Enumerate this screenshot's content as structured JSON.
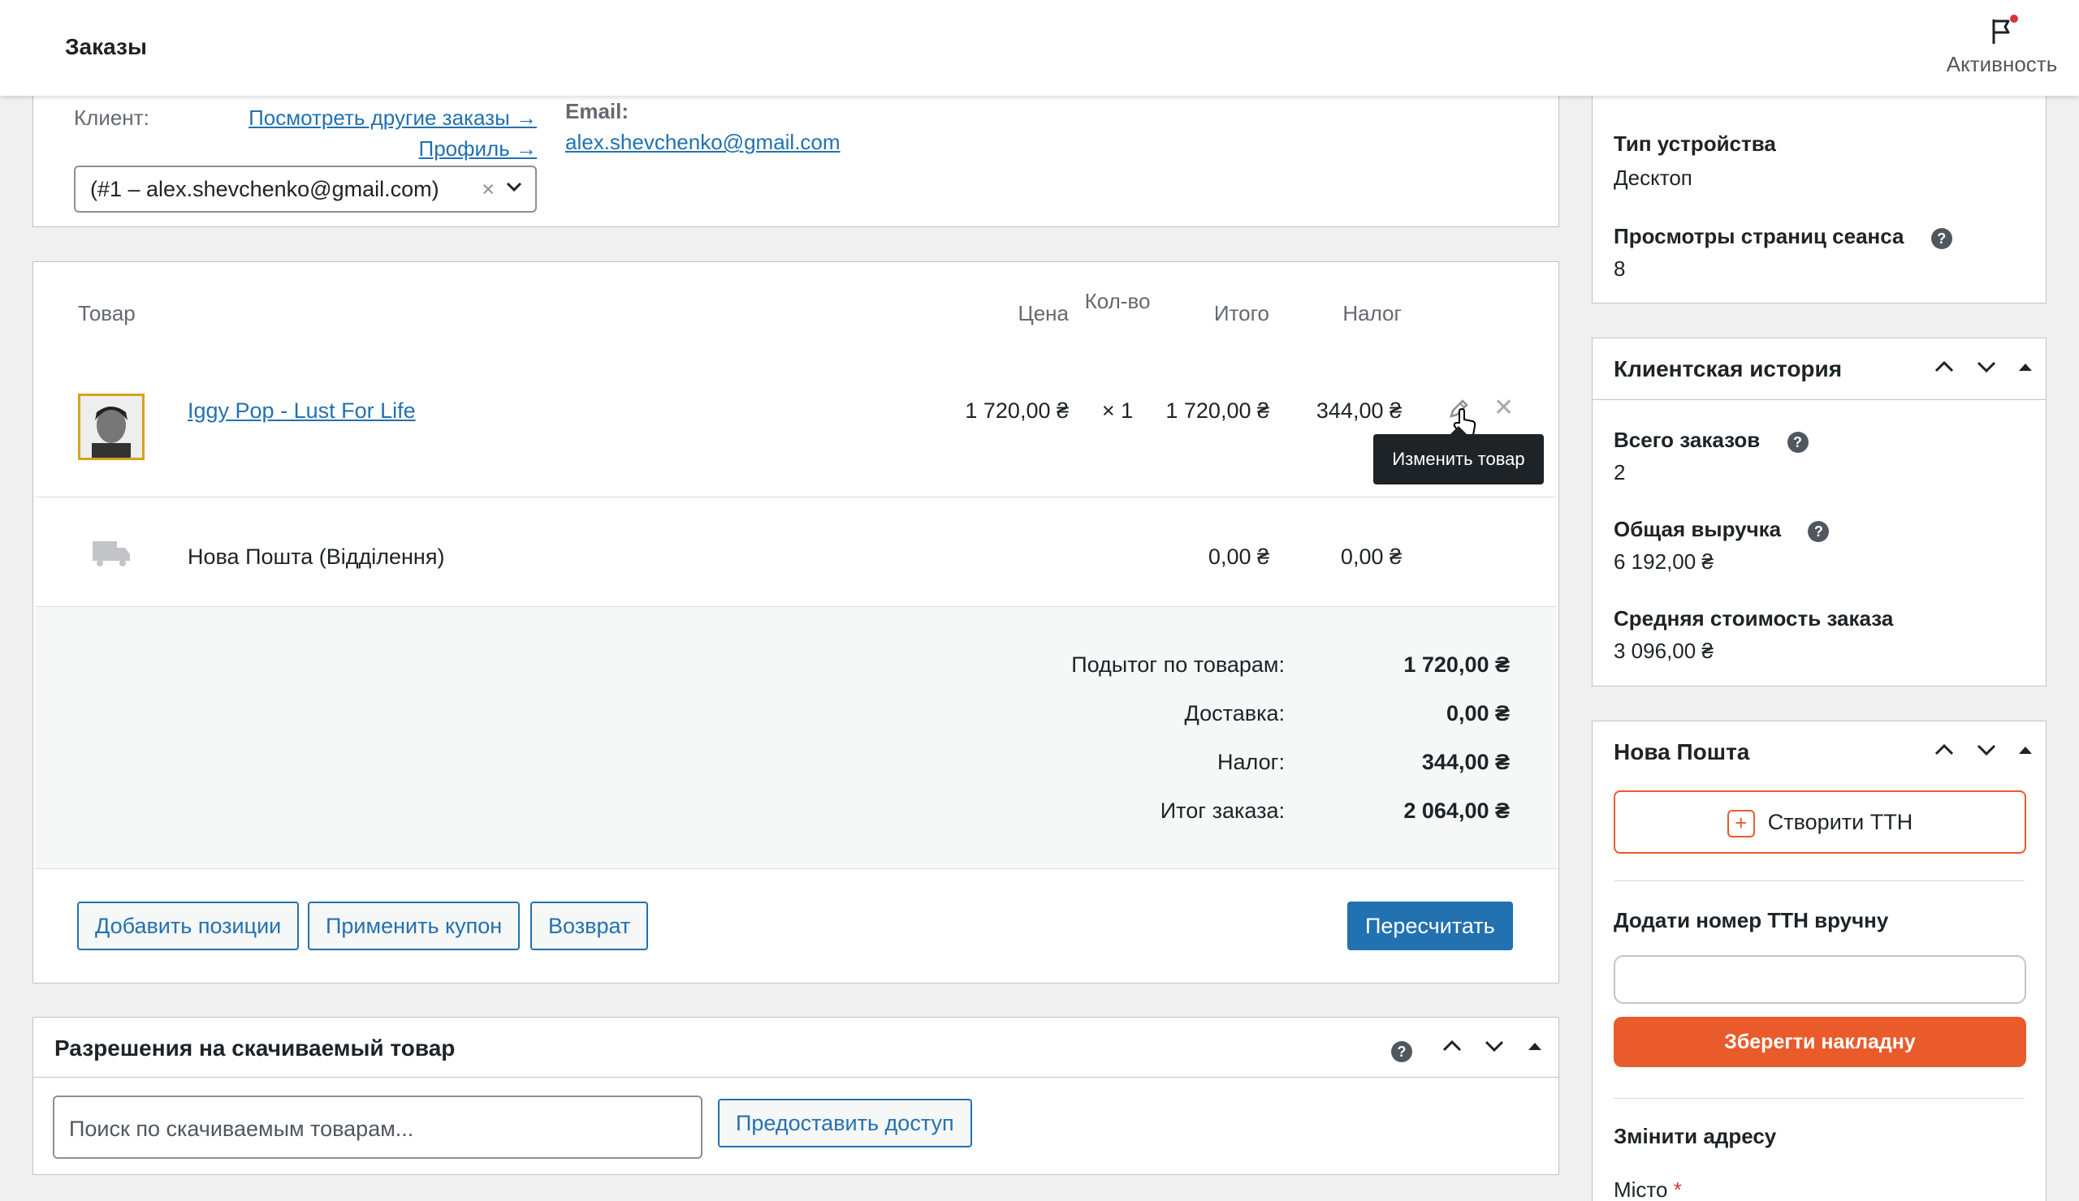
{
  "header": {
    "title": "Заказы",
    "activity_label": "Активность"
  },
  "customer": {
    "client_label": "Клиент:",
    "other_orders_link": "Посмотреть другие заказы →",
    "profile_link": "Профиль →",
    "select_value": "(#1 – alex.shevchenko@gmail.com)",
    "email_label": "Email:",
    "email_value": "alex.shevchenko@gmail.com"
  },
  "items": {
    "columns": {
      "product": "Товар",
      "price": "Цена",
      "qty": "Кол-во",
      "total": "Итого",
      "tax": "Налог"
    },
    "product": {
      "name": "Iggy Pop - Lust For Life",
      "price": "1 720,00 ₴",
      "qty": "× 1",
      "total": "1 720,00 ₴",
      "tax": "344,00 ₴"
    },
    "tooltip": "Изменить товар",
    "shipping": {
      "name": "Нова Пошта (Відділення)",
      "total": "0,00 ₴",
      "tax": "0,00 ₴"
    },
    "totals": {
      "subtotal_label": "Подытог по товарам:",
      "subtotal_value": "1 720,00 ₴",
      "shipping_label": "Доставка:",
      "shipping_value": "0,00 ₴",
      "tax_label": "Налог:",
      "tax_value": "344,00 ₴",
      "order_total_label": "Итог заказа:",
      "order_total_value": "2 064,00 ₴"
    },
    "buttons": {
      "add_items": "Добавить позиции",
      "apply_coupon": "Применить купон",
      "refund": "Возврат",
      "recalculate": "Пересчитать"
    }
  },
  "downloads": {
    "title": "Разрешения на скачиваемый товар",
    "search_placeholder": "Поиск по скачиваемым товарам...",
    "grant_button": "Предоставить доступ"
  },
  "sidebar": {
    "session": {
      "device_label": "Тип устройства",
      "device_value": "Десктоп",
      "pageviews_label": "Просмотры страниц сеанса",
      "pageviews_value": "8"
    },
    "history": {
      "title": "Клиентская история",
      "total_orders_label": "Всего заказов",
      "total_orders_value": "2",
      "revenue_label": "Общая выручка",
      "revenue_value": "6 192,00 ₴",
      "avg_label": "Средняя стоимость заказа",
      "avg_value": "3 096,00 ₴"
    },
    "nova_poshta": {
      "title": "Нова Пошта",
      "create_button": "Створити ТТН",
      "manual_label": "Додати номер ТТН вручну",
      "save_button": "Зберегти накладну",
      "change_address": "Змінити адресу",
      "city_label": "Місто",
      "required_mark": "*"
    }
  },
  "colors": {
    "accent": "#2271b1",
    "nova_poshta": "#e95b2b"
  }
}
